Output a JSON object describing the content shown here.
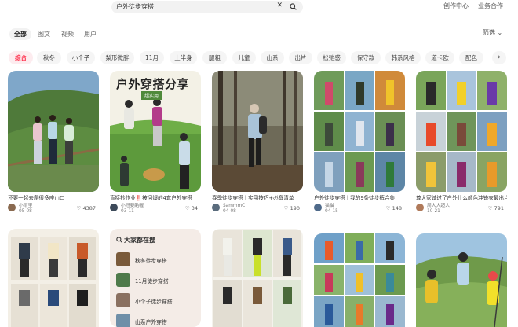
{
  "search": {
    "query": "户外徒步穿搭",
    "clear_icon": "close-icon",
    "search_icon": "search-icon"
  },
  "top_links": {
    "creator": "创作中心",
    "business": "业务合作"
  },
  "type_tabs": [
    "全部",
    "图文",
    "视频",
    "用户"
  ],
  "filter_label": "筛选",
  "chips": [
    "综合",
    "秋冬",
    "小个子",
    "梨形微胖",
    "11月",
    "上半身",
    "腿粗",
    "儿童",
    "山系",
    "出片",
    "松弛感",
    "保守款",
    "韩系风格",
    "道卡欧",
    "配色"
  ],
  "cards": [
    {
      "caption": "还要一起去爬很多座山口",
      "author": "小雨里",
      "date": "05-08",
      "likes": "4387"
    },
    {
      "caption": "直接抄作业‼️被问爆的4套户外穿搭",
      "author": "小冠要酷喔",
      "date": "03-11",
      "likes": "34",
      "overlay_title": "户外穿搭分享",
      "overlay_tag": "超实用"
    },
    {
      "caption": "春季徒步穿搭｜实用技巧+必备清单",
      "author": "SammmC",
      "date": "04-08",
      "likes": "190"
    },
    {
      "caption": "户外徒步穿搭｜我的9条徒步裤合集",
      "author": "猫猫",
      "date": "04-15",
      "likes": "148"
    },
    {
      "caption": "尊大家试过了户外什么颜色冲锋衣最出片口",
      "author": "周大大超人",
      "date": "10-21",
      "likes": "791"
    }
  ],
  "hot_searches": {
    "title": "大家都在搜",
    "items": [
      "秋冬徒步穿搭",
      "11月徒步穿搭",
      "小个子徒步穿搭",
      "山系户外穿搭"
    ]
  }
}
